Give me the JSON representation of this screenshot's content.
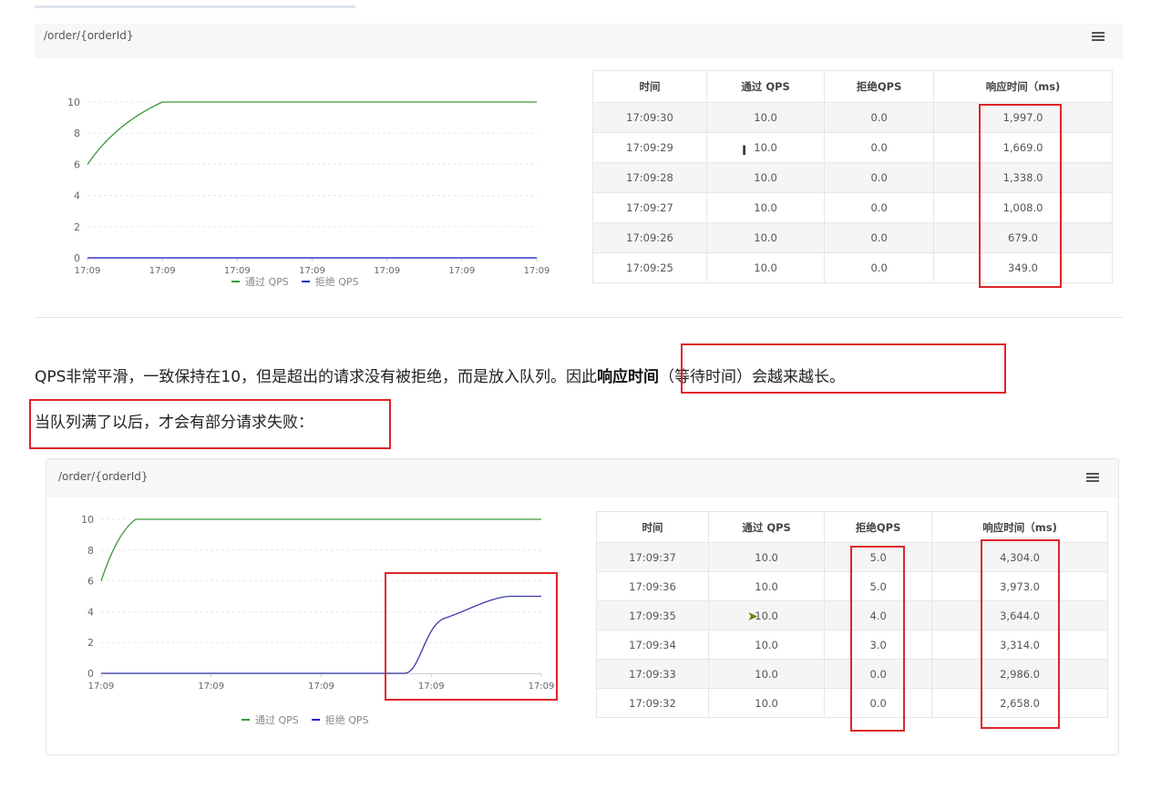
{
  "panel1": {
    "title": "/order/{orderId}",
    "menu_icon": "hamburger-menu-icon",
    "chart_data": {
      "type": "line",
      "x": [
        "17:09",
        "17:09",
        "17:09",
        "17:09",
        "17:09",
        "17:09",
        "17:09"
      ],
      "ylim": [
        0,
        10
      ],
      "yticks": [
        0,
        2,
        4,
        6,
        8,
        10
      ],
      "series": [
        {
          "name": "通过 QPS",
          "color": "#3a9a3a",
          "values": [
            6,
            10,
            10,
            10,
            10,
            10,
            10
          ]
        },
        {
          "name": "拒绝 QPS",
          "color": "#1f1fd6",
          "values": [
            0,
            0,
            0,
            0,
            0,
            0,
            0
          ]
        }
      ],
      "legend_position": "bottom-center"
    },
    "table": {
      "headers": [
        "时间",
        "通过 QPS",
        "拒绝QPS",
        "响应时间（ms)"
      ],
      "rows": [
        [
          "17:09:30",
          "10.0",
          "0.0",
          "1,997.0"
        ],
        [
          "17:09:29",
          "10.0",
          "0.0",
          "1,669.0"
        ],
        [
          "17:09:28",
          "10.0",
          "0.0",
          "1,338.0"
        ],
        [
          "17:09:27",
          "10.0",
          "0.0",
          "1,008.0"
        ],
        [
          "17:09:26",
          "10.0",
          "0.0",
          "679.0"
        ],
        [
          "17:09:25",
          "10.0",
          "0.0",
          "349.0"
        ]
      ]
    }
  },
  "para1": {
    "text1": "QPS非常平滑，一致保持在10，但是超出的请求没有被拒绝，而是放入队列。因此",
    "bold": "响应时间",
    "text2": "（等待时间）会越来越长。"
  },
  "para2": {
    "text": "当队列满了以后，才会有部分请求失败："
  },
  "panel2": {
    "title": "/order/{orderId}",
    "menu_icon": "hamburger-menu-icon",
    "chart_data": {
      "type": "line",
      "x": [
        "17:09",
        "17:09",
        "17:09",
        "17:09",
        "17:09"
      ],
      "ylim": [
        0,
        10
      ],
      "yticks": [
        0,
        2,
        4,
        6,
        8,
        10
      ],
      "series": [
        {
          "name": "通过 QPS",
          "color": "#3a9a3a",
          "values": [
            6,
            10,
            10,
            10,
            10,
            10,
            10,
            10,
            10
          ]
        },
        {
          "name": "拒绝 QPS",
          "color": "#3a3aa8",
          "values": [
            0,
            0,
            0,
            0,
            0,
            0,
            3,
            4,
            5,
            5
          ]
        }
      ],
      "legend_position": "bottom-center"
    },
    "table": {
      "headers": [
        "时间",
        "通过 QPS",
        "拒绝QPS",
        "响应时间（ms)"
      ],
      "rows": [
        [
          "17:09:37",
          "10.0",
          "5.0",
          "4,304.0"
        ],
        [
          "17:09:36",
          "10.0",
          "5.0",
          "3,973.0"
        ],
        [
          "17:09:35",
          "10.0",
          "4.0",
          "3,644.0"
        ],
        [
          "17:09:34",
          "10.0",
          "3.0",
          "3,314.0"
        ],
        [
          "17:09:33",
          "10.0",
          "0.0",
          "2,986.0"
        ],
        [
          "17:09:32",
          "10.0",
          "0.0",
          "2,658.0"
        ]
      ]
    }
  },
  "colors": {
    "highlight_box": "#e0232b",
    "pass_series": "#3a9a3a",
    "reject_series": "#1f1fd6"
  }
}
